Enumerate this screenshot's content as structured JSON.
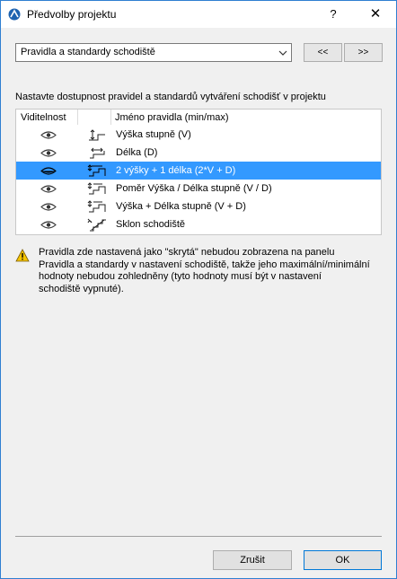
{
  "window": {
    "title": "Předvolby projektu",
    "help_label": "?",
    "close_label": "✕"
  },
  "preset": {
    "value": "Pravidla a standardy schodiště"
  },
  "nav": {
    "prev_label": "<<",
    "next_label": ">>"
  },
  "instruction": "Nastavte dostupnost pravidel a standardů vytváření schodišť v projektu",
  "grid": {
    "col_visibility": "Viditelnost",
    "col_name": "Jméno pravidla (min/max)",
    "rows": [
      {
        "name": "Výška stupně (V)",
        "icon": "riser-height-icon",
        "visible": true,
        "selected": false
      },
      {
        "name": "Délka (D)",
        "icon": "tread-length-icon",
        "visible": true,
        "selected": false
      },
      {
        "name": "2 výšky + 1 délka (2*V + D)",
        "icon": "step-formula-icon",
        "visible": false,
        "selected": true
      },
      {
        "name": "Poměr Výška / Délka stupně (V / D)",
        "icon": "riser-tread-ratio-icon",
        "visible": true,
        "selected": false
      },
      {
        "name": "Výška + Délka stupně (V + D)",
        "icon": "riser-plus-tread-icon",
        "visible": true,
        "selected": false
      },
      {
        "name": "Sklon schodiště",
        "icon": "stair-slope-icon",
        "visible": true,
        "selected": false
      }
    ]
  },
  "warning": {
    "line1": "Pravidla zde nastavená jako \"skrytá\" nebudou zobrazena na panelu",
    "line2": "Pravidla a standardy v nastavení schodiště, takže jeho maximální/minimální",
    "line3": "hodnoty nebudou zohledněny (tyto hodnoty musí být v nastavení",
    "line4": "schodiště vypnuté)."
  },
  "buttons": {
    "cancel": "Zrušit",
    "ok": "OK"
  },
  "colors": {
    "selection": "#3399ff",
    "frame": "#2f7fd1",
    "warning": "#f5c400"
  }
}
